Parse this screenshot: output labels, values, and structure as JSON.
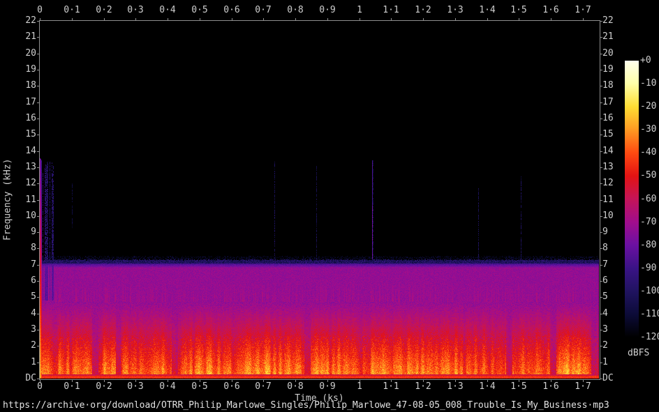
{
  "figure": {
    "bg_color": "#000000",
    "axis_color": "#8f8f8f",
    "label_color": "#cfcfcf"
  },
  "chart_data": {
    "type": "heatmap",
    "subtype": "audio-spectrogram",
    "xlabel": "Time (ks)",
    "ylabel": "Frequency (kHz)",
    "xlim_ks": [
      0,
      1.75
    ],
    "ylim_khz": [
      0,
      22
    ],
    "x_ticks": [
      {
        "v": 0.0,
        "label": "0"
      },
      {
        "v": 0.1,
        "label": "0·1"
      },
      {
        "v": 0.2,
        "label": "0·2"
      },
      {
        "v": 0.3,
        "label": "0·3"
      },
      {
        "v": 0.4,
        "label": "0·4"
      },
      {
        "v": 0.5,
        "label": "0·5"
      },
      {
        "v": 0.6,
        "label": "0·6"
      },
      {
        "v": 0.7,
        "label": "0·7"
      },
      {
        "v": 0.8,
        "label": "0·8"
      },
      {
        "v": 0.9,
        "label": "0·9"
      },
      {
        "v": 1.0,
        "label": "1"
      },
      {
        "v": 1.1,
        "label": "1·1"
      },
      {
        "v": 1.2,
        "label": "1·2"
      },
      {
        "v": 1.3,
        "label": "1·3"
      },
      {
        "v": 1.4,
        "label": "1·4"
      },
      {
        "v": 1.5,
        "label": "1·5"
      },
      {
        "v": 1.6,
        "label": "1·6"
      },
      {
        "v": 1.7,
        "label": "1·7"
      }
    ],
    "y_ticks": [
      {
        "v": 22,
        "label": "22"
      },
      {
        "v": 21,
        "label": "21"
      },
      {
        "v": 20,
        "label": "20"
      },
      {
        "v": 19,
        "label": "19"
      },
      {
        "v": 18,
        "label": "18"
      },
      {
        "v": 17,
        "label": "17"
      },
      {
        "v": 16,
        "label": "16"
      },
      {
        "v": 15,
        "label": "15"
      },
      {
        "v": 14,
        "label": "14"
      },
      {
        "v": 13,
        "label": "13"
      },
      {
        "v": 12,
        "label": "12"
      },
      {
        "v": 11,
        "label": "11"
      },
      {
        "v": 10,
        "label": "10"
      },
      {
        "v": 9,
        "label": "9"
      },
      {
        "v": 8,
        "label": "8"
      },
      {
        "v": 7,
        "label": "7"
      },
      {
        "v": 6,
        "label": "6"
      },
      {
        "v": 5,
        "label": "5"
      },
      {
        "v": 4,
        "label": "4"
      },
      {
        "v": 3,
        "label": "3"
      },
      {
        "v": 2,
        "label": "2"
      },
      {
        "v": 1,
        "label": "1"
      },
      {
        "v": 0,
        "label": "DC"
      }
    ],
    "colorbar": {
      "label": "dBFS",
      "tick_labels": [
        "+0",
        "-10",
        "-20",
        "-30",
        "-40",
        "-50",
        "-60",
        "-70",
        "-80",
        "-90",
        "-100",
        "-110",
        "-120"
      ],
      "palette": [
        [
          0,
          "#ffffee"
        ],
        [
          -10,
          "#ffffa8"
        ],
        [
          -20,
          "#ffdd33"
        ],
        [
          -30,
          "#ff9922"
        ],
        [
          -40,
          "#ff4a11"
        ],
        [
          -50,
          "#e31313"
        ],
        [
          -60,
          "#c41458"
        ],
        [
          -70,
          "#a10d8c"
        ],
        [
          -80,
          "#6b10a2"
        ],
        [
          -90,
          "#3a1386"
        ],
        [
          -100,
          "#201360"
        ],
        [
          -110,
          "#0c0b38"
        ],
        [
          -120,
          "#000000"
        ]
      ]
    },
    "content": {
      "noise_band": {
        "top_khz": 7.3,
        "edge_strip_khz": [
          7.06,
          7.3
        ],
        "edge_strip_level_db": -101,
        "body_level_db": -72.5
      },
      "speech_region": {
        "top_khz": 4.7,
        "base_level_db": -72.5,
        "max_level_db": -20,
        "dc_line_level_db": -45,
        "dc_underline_level_db": -56
      },
      "intro_transient": {
        "columns": 3,
        "top_khz": 13.55,
        "levels_db": [
          -24,
          -31,
          -40
        ],
        "slope_db_per_khz": 3.9
      },
      "intro_hiss_bundle": {
        "col_range": [
          3,
          20
        ],
        "top_khz_range": [
          12.6,
          13.45
        ],
        "level_db": -94,
        "density": 0.55
      },
      "spikes": [
        {
          "t": 0.1,
          "top_khz": 12.0,
          "bottom_khz": 9.2,
          "level_db": -109,
          "dashed": true
        },
        {
          "t": 0.734,
          "top_khz": 13.3,
          "level_db": -103,
          "dashed": true
        },
        {
          "t": 0.865,
          "top_khz": 13.1,
          "level_db": -105,
          "dashed": true
        },
        {
          "t": 1.04,
          "top_khz": 13.4,
          "level_db": -88,
          "dashed": false,
          "bright": true
        },
        {
          "t": 1.372,
          "top_khz": 11.7,
          "level_db": -104,
          "dashed": true
        },
        {
          "t": 1.506,
          "top_khz": 12.4,
          "level_db": -103,
          "dashed": true
        }
      ]
    }
  },
  "footer": {
    "url": "https://archive·org/download/OTRR_Philip_Marlowe_Singles/Philip_Marlowe_47-08-05_008_Trouble_Is_My_Business·mp3"
  }
}
